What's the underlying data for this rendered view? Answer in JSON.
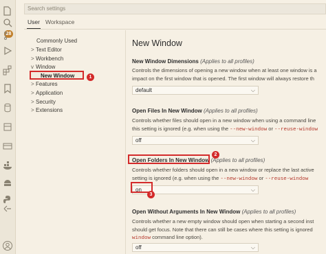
{
  "activity_bar": {
    "icons": [
      "files-icon",
      "search-icon",
      "source-control-icon",
      "run-debug-icon",
      "extensions-icon",
      "bookmark-icon",
      "database-icon",
      "notebook-icon",
      "remote-explorer-icon",
      "docker-icon",
      "android-icon",
      "python-icon",
      "git-graph-icon",
      "account-icon"
    ],
    "badge": "28"
  },
  "search": {
    "placeholder": "Search settings"
  },
  "tabs": [
    {
      "label": "User"
    },
    {
      "label": "Workspace"
    }
  ],
  "toc": [
    {
      "label": "Commonly Used",
      "chevron": ""
    },
    {
      "label": "Text Editor",
      "chevron": ">"
    },
    {
      "label": "Workbench",
      "chevron": ">"
    },
    {
      "label": "Window",
      "chevron": "v"
    },
    {
      "label": "New Window",
      "chevron": ""
    },
    {
      "label": "Features",
      "chevron": ">"
    },
    {
      "label": "Application",
      "chevron": ">"
    },
    {
      "label": "Security",
      "chevron": ">"
    },
    {
      "label": "Extensions",
      "chevron": ">"
    }
  ],
  "markers": [
    "1",
    "2",
    "3"
  ],
  "main": {
    "section_title": "New Window",
    "settings": [
      {
        "title": "New Window Dimensions",
        "scope": "(Applies to all profiles)",
        "desc": [
          "Controls the dimensions of opening a new window when at least one window is a",
          "impact on the first window that is opened. The first window will always restore th"
        ],
        "value": "default"
      },
      {
        "title": "Open Files In New Window",
        "scope": "(Applies to all profiles)",
        "desc": [
          "Controls whether files should open in a new window when using a command line",
          "this setting is ignored (e.g. when using the "
        ],
        "code1": "--new-window",
        "or": " or ",
        "code2": "--reuse-window",
        "value": "off"
      },
      {
        "title": "Open Folders In New Window",
        "scope": "(Applies to all profiles)",
        "desc": [
          "Controls whether folders should open in a new window or replace the last active",
          "setting is ignored (e.g. when using the "
        ],
        "code1": "--new-window",
        "or": " or ",
        "code2": "--reuse-window",
        "value": "on"
      },
      {
        "title": "Open Without Arguments In New Window",
        "scope": "(Applies to all profiles)",
        "desc": [
          "Controls whether a new empty window should open when starting a second inst",
          "should get focus. Note that there can still be cases where this setting is ignored",
          " command line option)."
        ],
        "code1": "window",
        "value": "off"
      }
    ]
  }
}
